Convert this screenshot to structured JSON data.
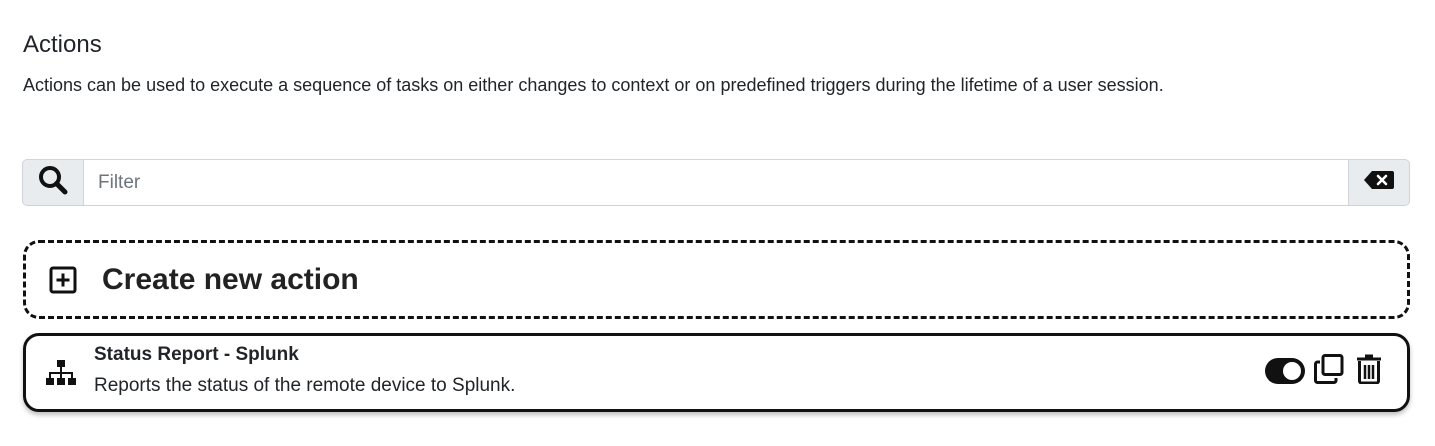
{
  "header": {
    "title": "Actions",
    "description": "Actions can be used to execute a sequence of tasks on either changes to context or on predefined triggers during the lifetime of a user session."
  },
  "filter": {
    "placeholder": "Filter",
    "value": "",
    "search_icon": "search-icon",
    "clear_icon": "backspace-icon"
  },
  "create": {
    "label": "Create new action",
    "icon": "plus-square-icon"
  },
  "actions": [
    {
      "title": "Status Report - Splunk",
      "description": "Reports the status of the remote device to Splunk.",
      "icon": "sitemap-icon",
      "enabled": true
    }
  ],
  "colors": {
    "border": "#111111",
    "addon_bg": "#e9ecef",
    "text": "#212529"
  }
}
